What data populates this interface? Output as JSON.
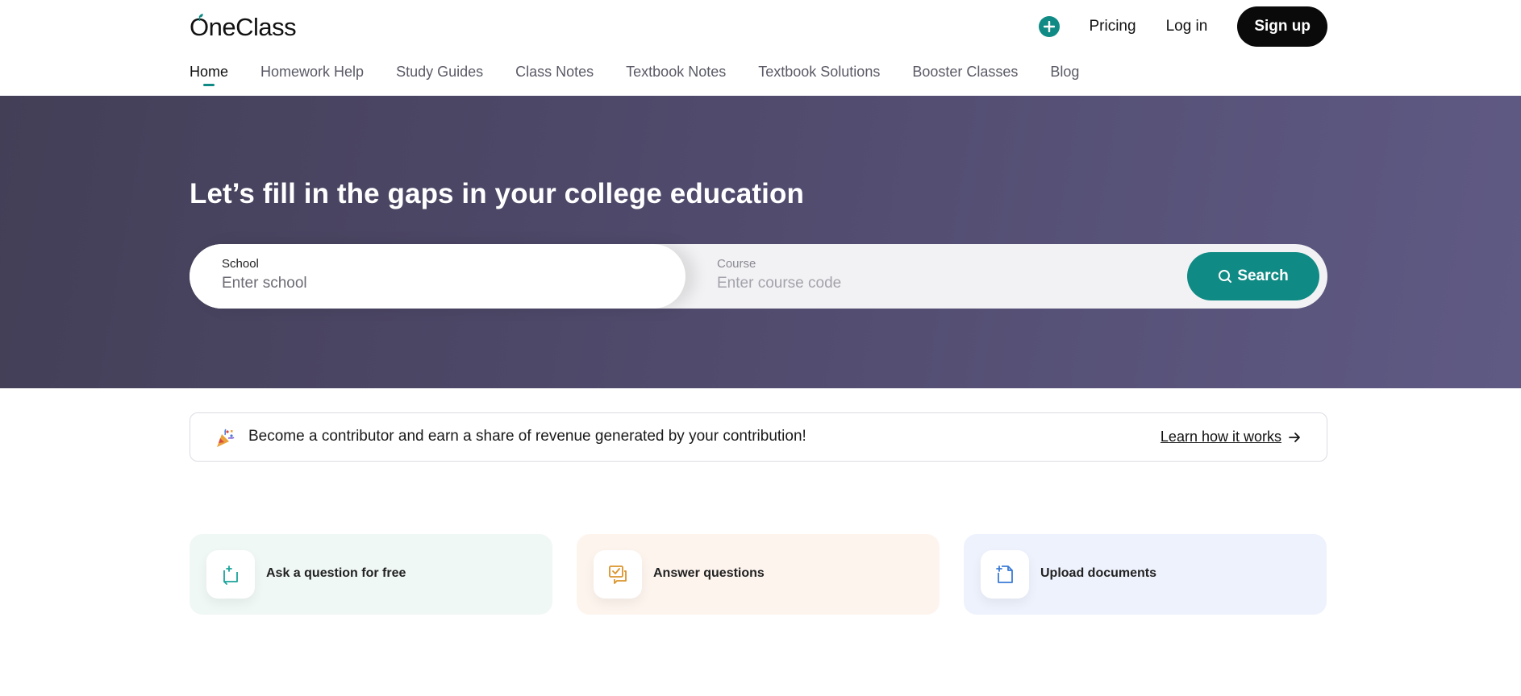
{
  "header": {
    "logo_text": "OneClass",
    "pricing_label": "Pricing",
    "login_label": "Log in",
    "signup_label": "Sign up"
  },
  "nav": {
    "items": [
      "Home",
      "Homework Help",
      "Study Guides",
      "Class Notes",
      "Textbook Notes",
      "Textbook Solutions",
      "Booster Classes",
      "Blog"
    ],
    "active": "Home"
  },
  "hero": {
    "title": "Let’s fill in the gaps in your college education",
    "school_label": "School",
    "school_placeholder": "Enter school",
    "course_label": "Course",
    "course_placeholder": "Enter course code",
    "search_label": "Search"
  },
  "banner": {
    "text": "Become a contributor and earn a share of revenue generated by your contribution!",
    "link_label": "Learn how it works"
  },
  "cards": [
    {
      "label": "Ask a question for free",
      "icon": "ask-question-icon"
    },
    {
      "label": "Answer questions",
      "icon": "answer-questions-icon"
    },
    {
      "label": "Upload documents",
      "icon": "upload-documents-icon"
    }
  ],
  "colors": {
    "accent": "#0f8a84",
    "hero_start": "#433f57",
    "hero_end": "#5f5a84",
    "signup_bg": "#0a0a0a"
  }
}
